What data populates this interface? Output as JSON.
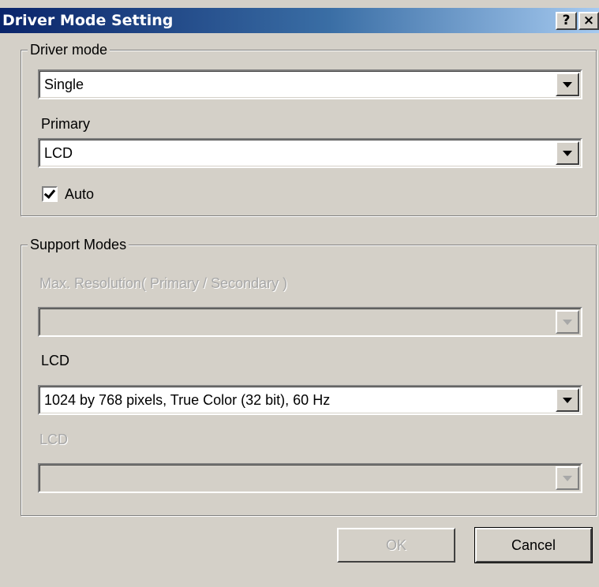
{
  "window": {
    "title": "Driver Mode Setting",
    "help_glyph": "?",
    "close_glyph": "×"
  },
  "driver_mode": {
    "legend": "Driver mode",
    "mode_value": "Single",
    "primary_label": "Primary",
    "primary_value": "LCD",
    "auto_label": "Auto",
    "auto_checked": true
  },
  "support_modes": {
    "legend": "Support Modes",
    "max_resolution_label": "Max. Resolution( Primary / Secondary )",
    "max_resolution_value": "",
    "primary_display_label": "LCD",
    "primary_display_value": "1024 by 768 pixels, True Color (32 bit), 60 Hz",
    "secondary_display_label": "LCD",
    "secondary_display_value": ""
  },
  "buttons": {
    "ok_label": "OK",
    "cancel_label": "Cancel"
  },
  "colors": {
    "face": "#d4d0c8",
    "title_start": "#0a246a",
    "title_end": "#a6caf0",
    "disabled_text": "#a8a8a8"
  }
}
